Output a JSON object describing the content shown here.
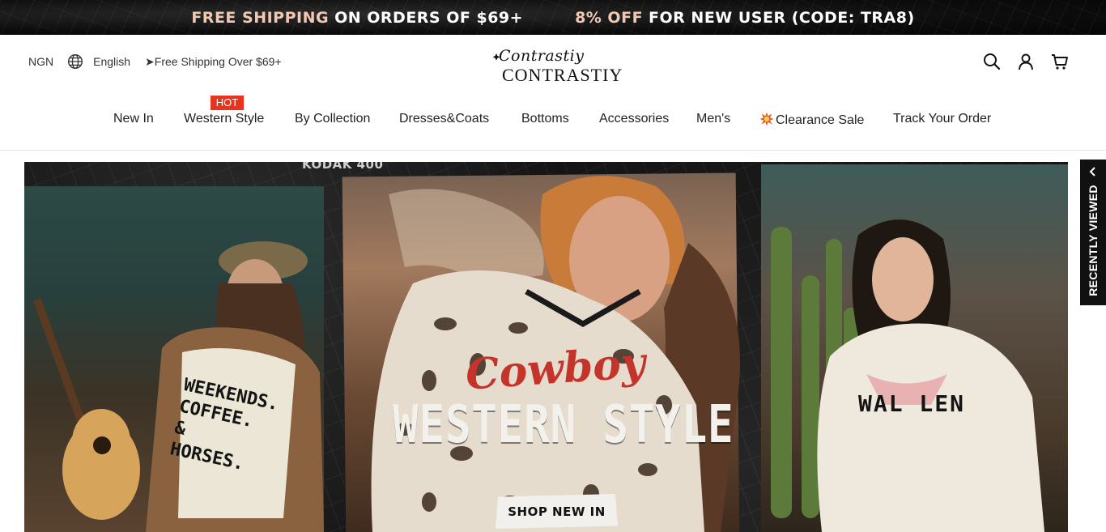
{
  "promo": {
    "left_highlight": "FREE SHIPPING",
    "left_rest": "ON ORDERS OF $69+",
    "right_highlight": "8% OFF",
    "right_rest": "FOR NEW USER (CODE: TRA8)"
  },
  "header": {
    "currency": "NGN",
    "language": "English",
    "shipping_note": "➤Free Shipping Over $69+",
    "logo_script": "Contrastiy",
    "logo_caps": "CONTRASTIY",
    "icons": [
      "search-icon",
      "account-icon",
      "cart-icon"
    ]
  },
  "nav": {
    "hot_badge": "HOT",
    "items": [
      {
        "label": "New In"
      },
      {
        "label": "Western Style"
      },
      {
        "label": "By Collection"
      },
      {
        "label": "Dresses&Coats"
      },
      {
        "label": "Bottoms"
      },
      {
        "label": "Accessories"
      },
      {
        "label": "Men's"
      },
      {
        "label": "Clearance Sale"
      },
      {
        "label": "Track Your Order"
      }
    ]
  },
  "hero": {
    "title": "WESTERN STYLE",
    "cta": "SHOP NEW IN",
    "film_mark": "KODAK 400",
    "tee_left": [
      "WEEKENDS.",
      "COFFEE.",
      "&",
      "HORSES."
    ],
    "tee_center": "Cowboy",
    "tee_right": "WAL LEN"
  },
  "recently_viewed": {
    "label": "RECENTLY VIEWED"
  },
  "colors": {
    "promo_highlight": "#f1c9b2",
    "hot_badge": "#e8341c",
    "side_tab": "#111111"
  }
}
